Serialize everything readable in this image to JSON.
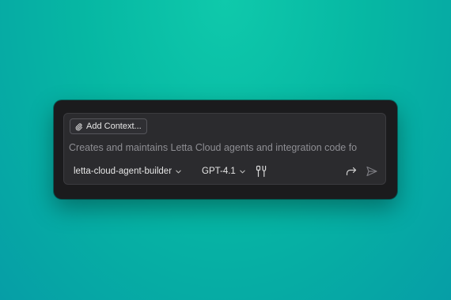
{
  "composer": {
    "add_context_label": "Add Context...",
    "prompt_text": "Creates and maintains Letta Cloud agents and integration code fo",
    "agent_selector": "letta-cloud-agent-builder",
    "model_selector": "GPT-4.1"
  },
  "icons": {
    "attach": "paperclip-icon",
    "agent_dropdown": "chevron-down-icon",
    "model_dropdown": "chevron-down-icon",
    "tools": "tools-icon",
    "forward": "forward-arrow-icon",
    "send": "send-icon"
  },
  "colors": {
    "background_accent": "#0fc9ab",
    "panel": "#1b1b1d",
    "composer": "#2b2b2e",
    "text": "#e6e6e6",
    "placeholder_text": "#8e8e93"
  }
}
